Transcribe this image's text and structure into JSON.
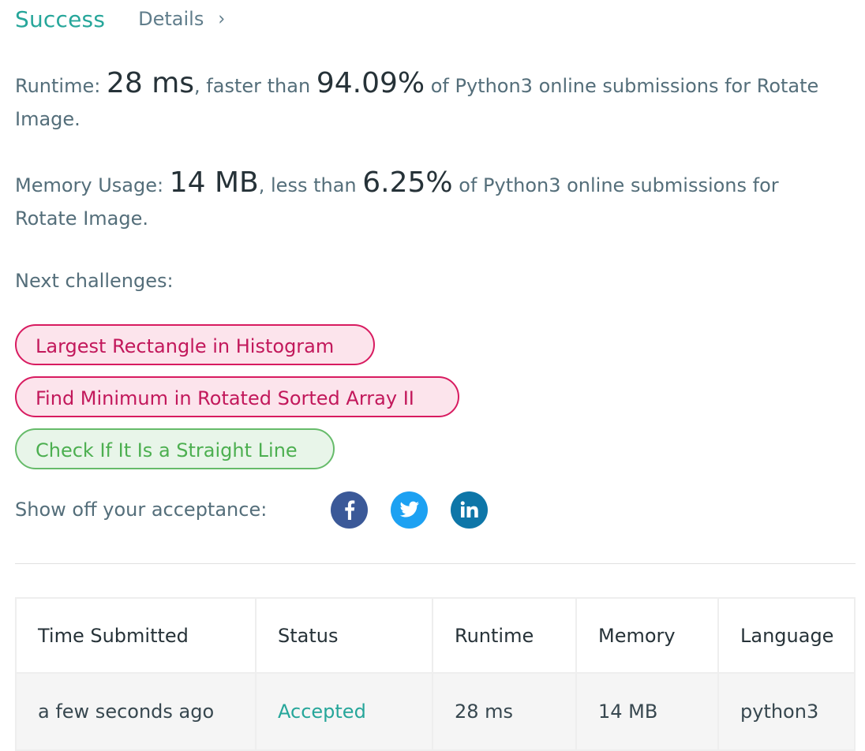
{
  "header": {
    "status": "Success",
    "details_label": "Details",
    "chevron": "›"
  },
  "runtime": {
    "label": "Runtime: ",
    "value": "28 ms",
    "compare_text": ", faster than ",
    "percent": "94.09%",
    "suffix": " of Python3 online submissions for Rotate Image."
  },
  "memory": {
    "label": "Memory Usage: ",
    "value": "14 MB",
    "compare_text": ", less than ",
    "percent": "6.25%",
    "suffix": " of Python3 online submissions for Rotate Image."
  },
  "next": {
    "label": "Next challenges:",
    "challenges": [
      {
        "title": "Largest Rectangle in Histogram",
        "difficulty": "hard"
      },
      {
        "title": "Find Minimum in Rotated Sorted Array II",
        "difficulty": "hard"
      },
      {
        "title": "Check If It Is a Straight Line",
        "difficulty": "easy"
      }
    ]
  },
  "share": {
    "label": "Show off your acceptance:",
    "icons": [
      {
        "name": "facebook-icon",
        "color": "#3b5998"
      },
      {
        "name": "twitter-icon",
        "color": "#1da1f2"
      },
      {
        "name": "linkedin-icon",
        "color": "#0e76a8"
      }
    ]
  },
  "submissions": {
    "columns": [
      "Time Submitted",
      "Status",
      "Runtime",
      "Memory",
      "Language"
    ],
    "rows": [
      {
        "time": "a few seconds ago",
        "status": "Accepted",
        "runtime": "28 ms",
        "memory": "14 MB",
        "language": "python3"
      }
    ]
  },
  "colors": {
    "success": "#26a69a",
    "hard_border": "#d81b60",
    "hard_bg": "#fce4ec",
    "easy_border": "#66bb6a",
    "easy_bg": "#e8f5e9"
  }
}
